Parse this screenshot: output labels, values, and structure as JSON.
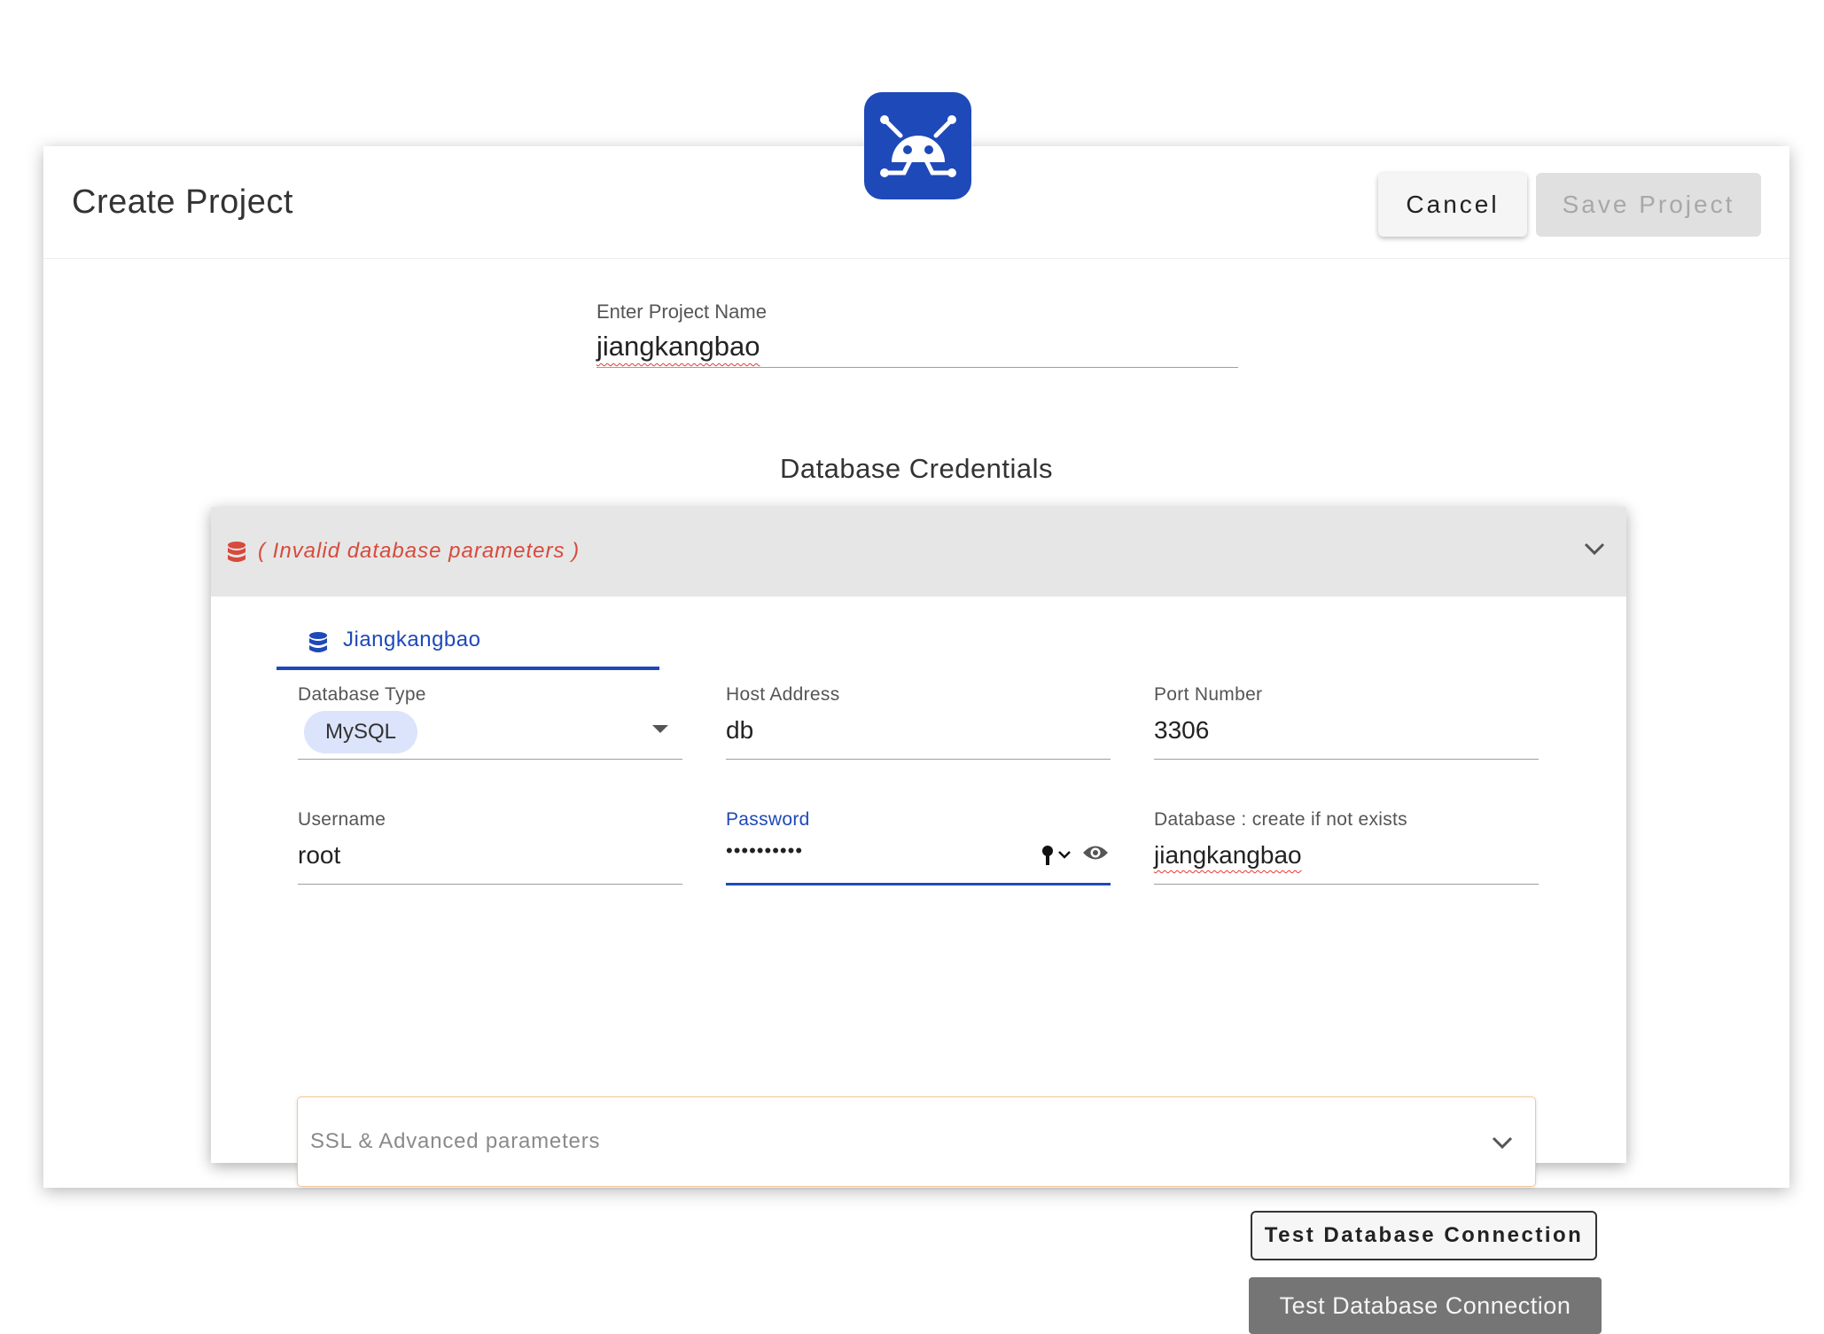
{
  "app": {
    "logo_icon": "nocodb-logo-icon",
    "brand_color": "#1e49b8"
  },
  "header": {
    "title": "Create Project",
    "cancel_label": "Cancel",
    "save_label": "Save Project"
  },
  "project": {
    "name_label": "Enter Project Name",
    "name_value": "jiangkangbao"
  },
  "credentials": {
    "section_title": "Database Credentials",
    "panel_status": "( Invalid database parameters )",
    "status_color": "#d84a3b",
    "tab_label": "Jiangkangbao",
    "fields": {
      "db_type": {
        "label": "Database Type",
        "value": "MySQL"
      },
      "host": {
        "label": "Host Address",
        "value": "db"
      },
      "port": {
        "label": "Port Number",
        "value": "3306"
      },
      "username": {
        "label": "Username",
        "value": "root"
      },
      "password": {
        "label": "Password",
        "value": "••••••••••"
      },
      "database": {
        "label": "Database : create if not exists",
        "value": "jiangkangbao"
      }
    },
    "ssl_label": "SSL & Advanced parameters",
    "test_button_label": "Test Database Connection",
    "tooltip_text": "Test Database Connection"
  }
}
